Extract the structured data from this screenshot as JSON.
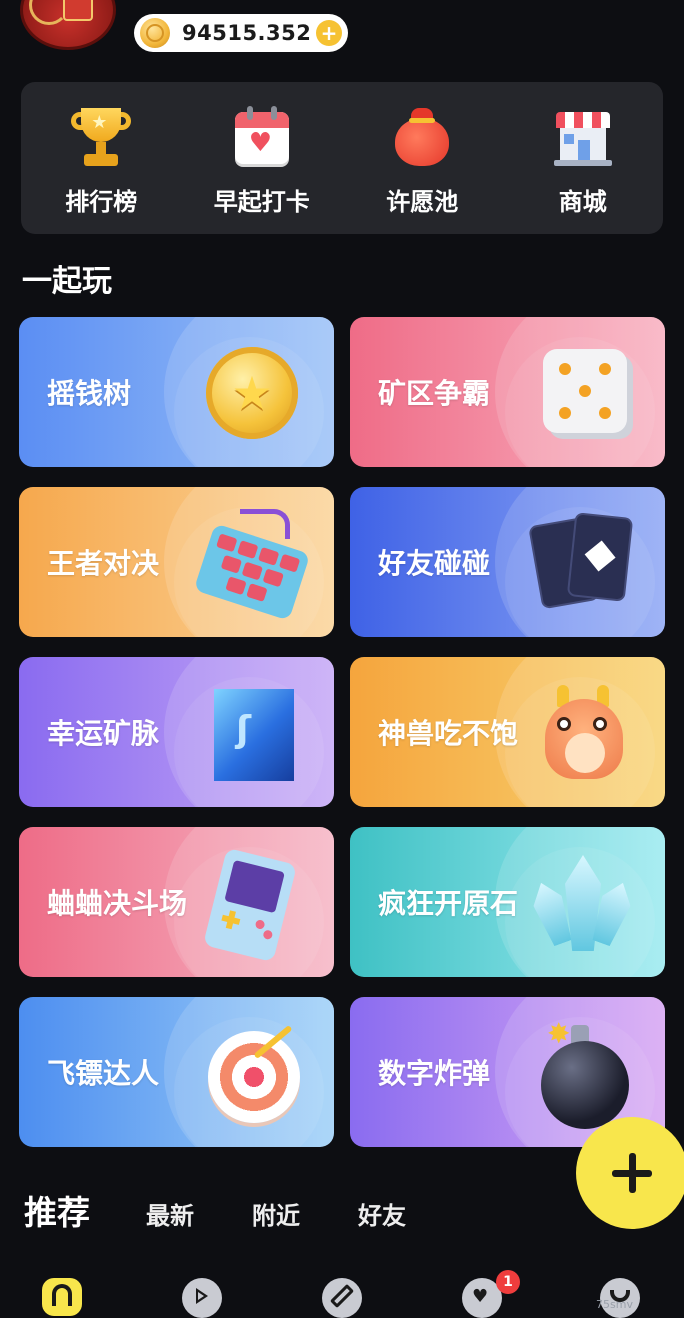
{
  "header": {
    "coin_balance": "94515.352"
  },
  "quick_actions": [
    {
      "label": "排行榜",
      "icon": "trophy-icon"
    },
    {
      "label": "早起打卡",
      "icon": "calendar-icon"
    },
    {
      "label": "许愿池",
      "icon": "lucky-bag-icon"
    },
    {
      "label": "商城",
      "icon": "shop-icon"
    }
  ],
  "section_title": "一起玩",
  "games": [
    {
      "label": "摇钱树",
      "icon": "gold-coin-icon",
      "color": "#5b8ef3"
    },
    {
      "label": "矿区争霸",
      "icon": "dice-icon",
      "color": "#ef6c87"
    },
    {
      "label": "王者对决",
      "icon": "keyboard-icon",
      "color": "#f6a84d"
    },
    {
      "label": "好友碰碰",
      "icon": "cards-icon",
      "color": "#3f62e6"
    },
    {
      "label": "幸运矿脉",
      "icon": "gem-icon",
      "color": "#8a6bf0"
    },
    {
      "label": "神兽吃不饱",
      "icon": "dragon-icon",
      "color": "#f5a53d"
    },
    {
      "label": "蛐蛐决斗场",
      "icon": "gameboy-icon",
      "color": "#ee6c87"
    },
    {
      "label": "疯狂开原石",
      "icon": "crystal-icon",
      "color": "#3fc1c4"
    },
    {
      "label": "飞镖达人",
      "icon": "target-icon",
      "color": "#4d8ef0"
    },
    {
      "label": "数字炸弹",
      "icon": "bomb-icon",
      "color": "#8a6cf0"
    }
  ],
  "feed_tabs": [
    {
      "label": "推荐",
      "active": true
    },
    {
      "label": "最新",
      "active": false
    },
    {
      "label": "附近",
      "active": false
    },
    {
      "label": "好友",
      "active": false
    }
  ],
  "bottom_nav": {
    "message_badge": "1"
  },
  "watermark": "75smv"
}
